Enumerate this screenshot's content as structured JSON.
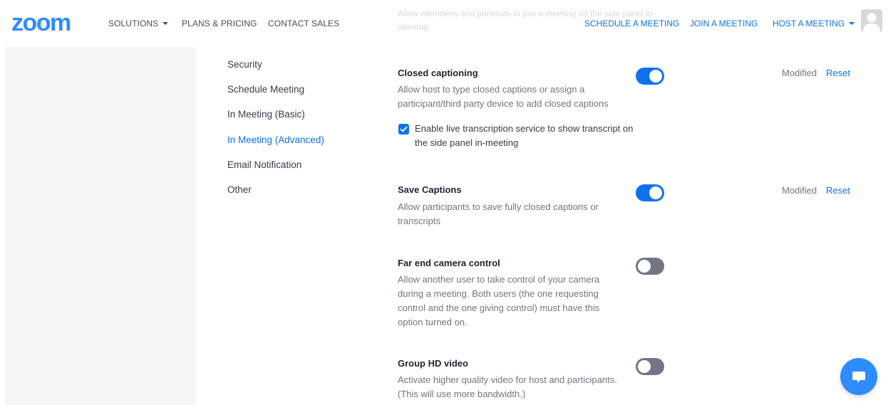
{
  "header": {
    "logo_text": "zoom",
    "nav_left": [
      "SOLUTIONS",
      "PLANS & PRICING",
      "CONTACT SALES"
    ],
    "nav_right": [
      "SCHEDULE A MEETING",
      "JOIN A MEETING",
      "HOST A MEETING"
    ],
    "ghost_text": "Allow attendees and panelists to join a meeting on the side panel in-meeting"
  },
  "menu": {
    "items": [
      "Security",
      "Schedule Meeting",
      "In Meeting (Basic)",
      "In Meeting (Advanced)",
      "Email Notification",
      "Other"
    ],
    "active": "In Meeting (Advanced)"
  },
  "settings": [
    {
      "title": "Closed captioning",
      "description": "Allow host to type closed captions or assign a participant/third party device to add closed captions",
      "enabled": true,
      "modified_label": "Modified",
      "reset_label": "Reset",
      "option": {
        "label": "Enable live transcription service to show transcript on the side panel in-meeting",
        "checked": true
      }
    },
    {
      "title": "Save Captions",
      "description": "Allow participants to save fully closed captions or transcripts",
      "enabled": true,
      "modified_label": "Modified",
      "reset_label": "Reset"
    },
    {
      "title": "Far end camera control",
      "description": "Allow another user to take control of your camera during a meeting. Both users (the one requesting control and the one giving control) must have this option turned on.",
      "enabled": false
    },
    {
      "title": "Group HD video",
      "description": "Activate higher quality video for host and participants. (This will use more bandwidth.)",
      "enabled": false
    }
  ],
  "colors": {
    "accent": "#0e72ed",
    "toggle_off": "#747487",
    "sidebar_bg": "#f4f5f6",
    "chat_button": "#2d8cff"
  },
  "icons": {
    "avatar": "user-avatar-icon",
    "chat": "chat-bubble-icon",
    "check": "checkmark-icon",
    "caret": "caret-down-icon"
  }
}
